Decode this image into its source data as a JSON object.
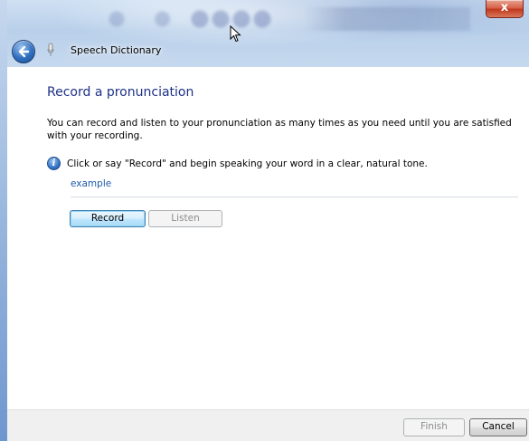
{
  "window": {
    "title": "Speech Dictionary",
    "close_label": "x"
  },
  "page": {
    "title": "Record a pronunciation",
    "description": "You can record and listen to your pronunciation as many times as you need until you are satisfied with your recording.",
    "info_text": "Click or say \"Record\" and begin speaking your word in a clear, natural tone.",
    "word": "example"
  },
  "buttons": {
    "record": "Record",
    "listen": "Listen",
    "finish": "Finish",
    "cancel": "Cancel"
  },
  "colors": {
    "title_blue": "#1e3287",
    "link_blue": "#1c5aa8"
  },
  "icons": {
    "back": "back-arrow-icon",
    "info": "info-icon",
    "app": "microphone-icon",
    "cursor": "mouse-pointer-icon"
  }
}
